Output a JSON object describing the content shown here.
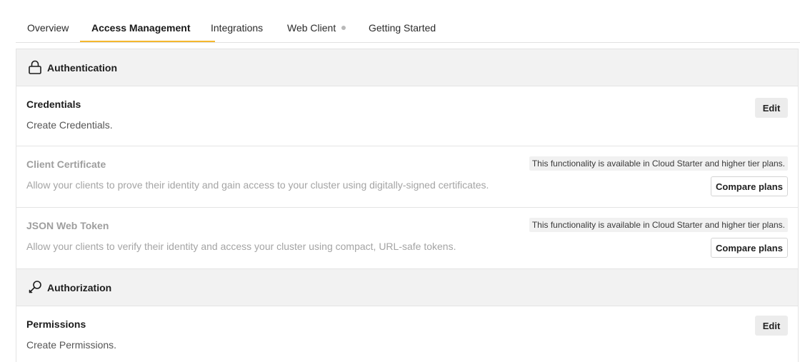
{
  "tabs": [
    {
      "label": "Overview"
    },
    {
      "label": "Access Management"
    },
    {
      "label": "Integrations"
    },
    {
      "label": "Web Client"
    },
    {
      "label": "Getting Started"
    }
  ],
  "active_tab": "Access Management",
  "colors": {
    "accent": "#f5b82e",
    "header_bg": "#f2f2f2",
    "border": "#e4e4e4"
  },
  "authentication": {
    "title": "Authentication",
    "icon": "lock-icon",
    "rows": [
      {
        "name": "Credentials",
        "description": "Create Credentials.",
        "action": "Edit"
      },
      {
        "name": "Client Certificate",
        "description": "Allow your clients to prove their identity and gain access to your cluster using digitally-signed certificates.",
        "notice": "This functionality is available in Cloud Starter and higher tier plans.",
        "action": "Compare plans"
      },
      {
        "name": "JSON Web Token",
        "description": "Allow your clients to verify their identity and access your cluster using compact, URL-safe tokens.",
        "notice": "This functionality is available in Cloud Starter and higher tier plans.",
        "action": "Compare plans"
      }
    ]
  },
  "authorization": {
    "title": "Authorization",
    "icon": "key-icon",
    "rows": [
      {
        "name": "Permissions",
        "description": "Create Permissions.",
        "action": "Edit"
      }
    ]
  }
}
